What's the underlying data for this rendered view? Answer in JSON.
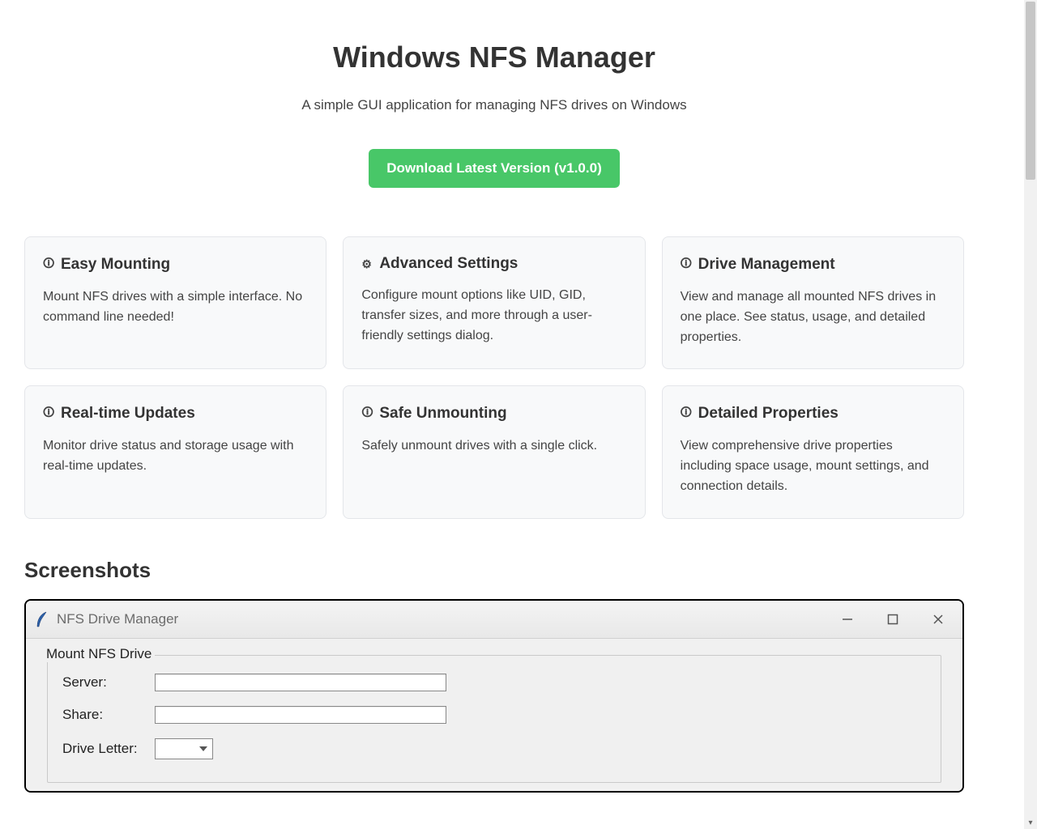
{
  "header": {
    "title": "Windows NFS Manager",
    "subtitle": "A simple GUI application for managing NFS drives on Windows",
    "download_label": "Download Latest Version (v1.0.0)"
  },
  "features": [
    {
      "icon": "🛈",
      "title": "Easy Mounting",
      "desc": "Mount NFS drives with a simple interface. No command line needed!"
    },
    {
      "icon": "⚙",
      "title": "Advanced Settings",
      "desc": "Configure mount options like UID, GID, transfer sizes, and more through a user-friendly settings dialog."
    },
    {
      "icon": "🛈",
      "title": "Drive Management",
      "desc": "View and manage all mounted NFS drives in one place. See status, usage, and detailed properties."
    },
    {
      "icon": "🛈",
      "title": "Real-time Updates",
      "desc": "Monitor drive status and storage usage with real-time updates."
    },
    {
      "icon": "🛈",
      "title": "Safe Unmounting",
      "desc": "Safely unmount drives with a single click."
    },
    {
      "icon": "🛈",
      "title": "Detailed Properties",
      "desc": "View comprehensive drive properties including space usage, mount settings, and connection details."
    }
  ],
  "screenshots_heading": "Screenshots",
  "screenshot": {
    "window_title": "NFS Drive Manager",
    "section_title": "Mount NFS Drive",
    "labels": {
      "server": "Server:",
      "share": "Share:",
      "drive_letter": "Drive Letter:"
    }
  }
}
